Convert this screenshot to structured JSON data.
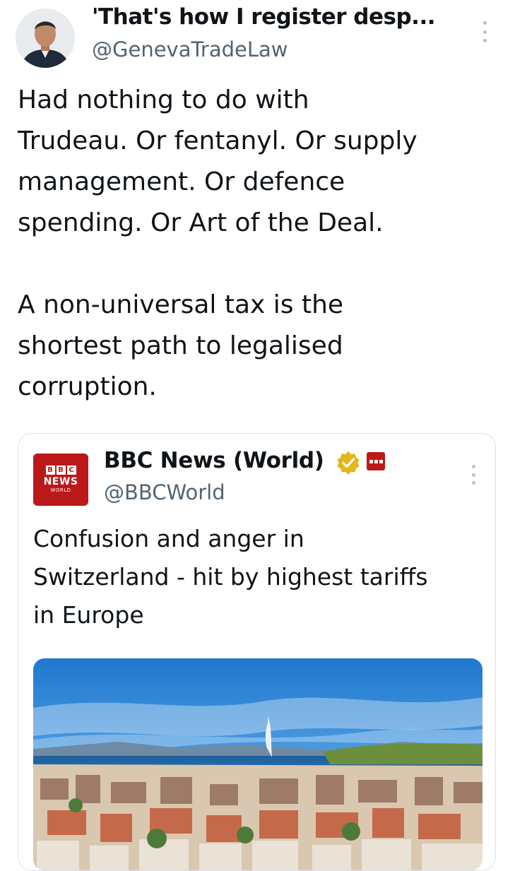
{
  "tweet": {
    "display_name": "'That's how I register desp...",
    "handle": "@GenevaTradeLaw",
    "text": "Had nothing to do with\nTrudeau. Or fentanyl. Or supply\nmanagement. Or defence\nspending. Or Art of the Deal.\n\nA non-universal tax is the\nshortest path to legalised\ncorruption.",
    "icons": {
      "avatar": "profile-photo",
      "more": "more-vertical-icon"
    }
  },
  "quote": {
    "display_name": "BBC News (World)",
    "handle": "@BBCWorld",
    "text": "Confusion and anger in\nSwitzerland - hit by highest tariffs\nin Europe",
    "logo": {
      "blocks": [
        "B",
        "B",
        "C"
      ],
      "line1": "NEWS",
      "line2": "WORLD"
    },
    "icons": {
      "verified": "verified-badge-icon",
      "affiliate": "bbc-affiliate-icon",
      "more": "more-vertical-icon",
      "media": "geneva-city-photo"
    }
  },
  "colors": {
    "text": "#0f1419",
    "secondary": "#536471",
    "bbc_red": "#bb1919",
    "verified_gold": "#e2b719",
    "border": "#dde3e8"
  }
}
